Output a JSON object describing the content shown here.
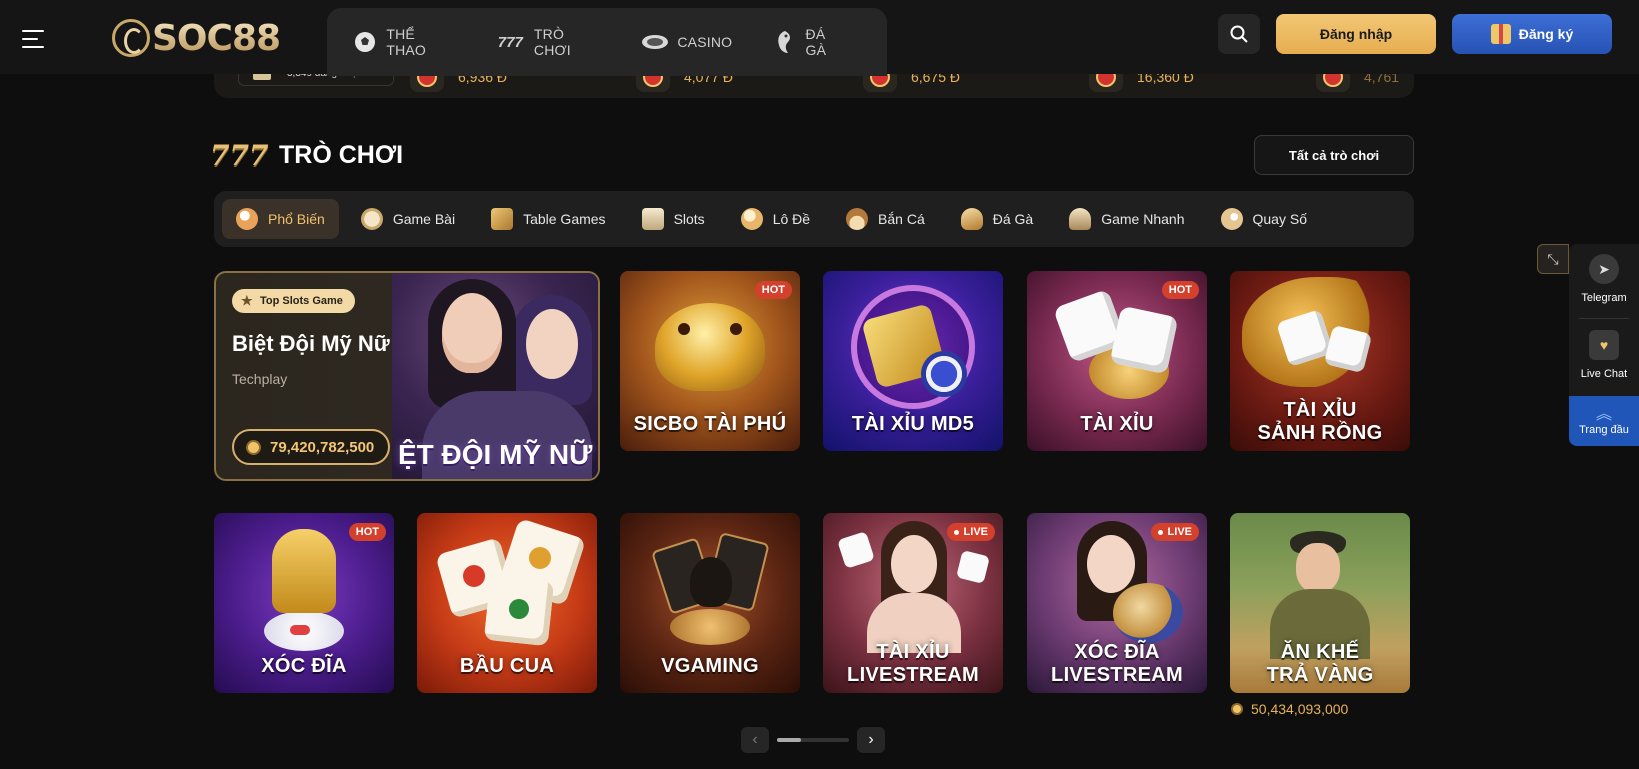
{
  "header": {
    "brand": "SOC88",
    "nav": [
      {
        "label": "THỂ THAO",
        "icon": "soccer-ball-icon"
      },
      {
        "label": "TRÒ CHƠI",
        "icon": "777-slots-icon"
      },
      {
        "label": "CASINO",
        "icon": "casino-chip-icon"
      },
      {
        "label": "ĐÁ GÀ",
        "icon": "rooster-icon"
      }
    ],
    "login_label": "Đăng nhập",
    "register_label": "Đăng ký"
  },
  "ticker": {
    "bettors": "3,349 đang cược",
    "items": [
      "6,936 Đ",
      "4,077 Đ",
      "6,675 Đ",
      "16,360 Đ",
      "4,761"
    ]
  },
  "section": {
    "title": "TRÒ CHƠI",
    "all_label": "Tất cả trò chơi"
  },
  "categories": [
    {
      "label": "Phổ Biến",
      "active": true,
      "color": "#e8a25a"
    },
    {
      "label": "Game Bài",
      "active": false,
      "color": "#e9d7b3"
    },
    {
      "label": "Table Games",
      "active": false,
      "color": "#e0b76a"
    },
    {
      "label": "Slots",
      "active": false,
      "color": "#d9c9a8"
    },
    {
      "label": "Lô Đề",
      "active": false,
      "color": "#e9b56a"
    },
    {
      "label": "Bắn Cá",
      "active": false,
      "color": "#d9a56a"
    },
    {
      "label": "Đá Gà",
      "active": false,
      "color": "#e0b070"
    },
    {
      "label": "Game Nhanh",
      "active": false,
      "color": "#d9c29a"
    },
    {
      "label": "Quay Số",
      "active": false,
      "color": "#e6c690"
    }
  ],
  "featured": {
    "badge": "Top Slots Game",
    "title": "Biệt Đội Mỹ Nữ",
    "provider": "Techplay",
    "jackpot": "79,420,782,500",
    "art_text": "ỆT ĐỘI MỸ NỮ"
  },
  "games": [
    {
      "line1": "SICBO TÀI PHÚ",
      "line2": "",
      "badge": "HOT"
    },
    {
      "line1": "TÀI XỈU MD5",
      "line2": "",
      "badge": ""
    },
    {
      "line1": "TÀI XỈU",
      "line2": "",
      "badge": "HOT"
    },
    {
      "line1": "TÀI XỈU",
      "line2": "SẢNH RỒNG",
      "badge": ""
    },
    {
      "line1": "XÓC ĐĨA",
      "line2": "",
      "badge": "HOT"
    },
    {
      "line1": "BẦU CUA",
      "line2": "",
      "badge": ""
    },
    {
      "line1": "VGAMING",
      "line2": "",
      "badge": ""
    },
    {
      "line1": "TÀI XỈU",
      "line2": "LIVESTREAM",
      "badge": "LIVE"
    },
    {
      "line1": "XÓC ĐĨA",
      "line2": "LIVESTREAM",
      "badge": "LIVE"
    },
    {
      "line1": "ĂN KHẾ",
      "line2": "TRẢ VÀNG",
      "badge": ""
    }
  ],
  "game_jackpot": "50,434,093,000",
  "floating": {
    "telegram": "Telegram",
    "live_chat": "Live Chat",
    "top": "Trang đầu"
  }
}
